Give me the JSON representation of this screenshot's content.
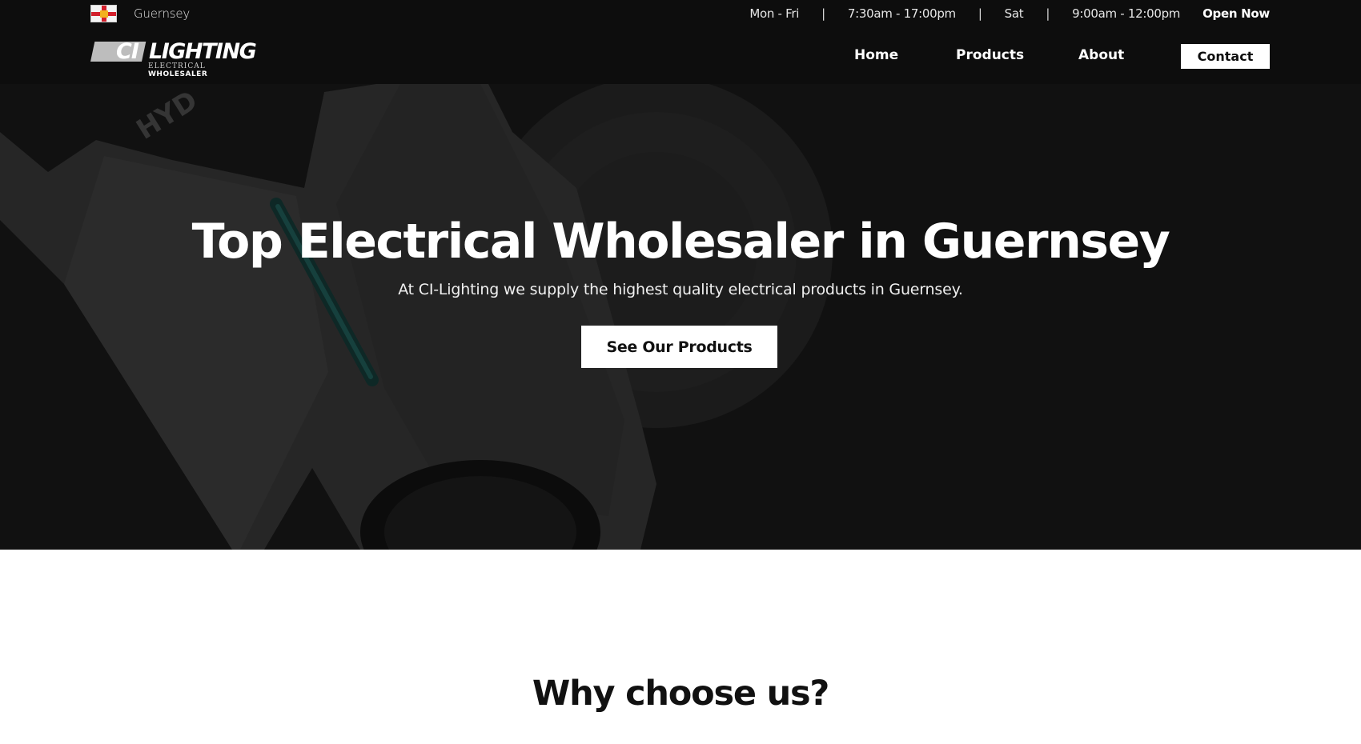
{
  "topbar": {
    "location": "Guernsey",
    "flag_icon": "guernsey-flag-icon",
    "weekday_label": "Mon - Fri",
    "weekday_hours": "7:30am - 17:00pm",
    "saturday_label": "Sat",
    "saturday_hours": "9:00am - 12:00pm",
    "status": "Open Now",
    "separator": "|"
  },
  "logo": {
    "mark": "CI",
    "name": "LIGHTING",
    "tagline_1": "ELECTRICAL",
    "tagline_2": "WHOLESALER"
  },
  "nav": {
    "home": "Home",
    "products": "Products",
    "about": "About",
    "contact": "Contact"
  },
  "hero": {
    "title": "Top Electrical Wholesaler in Guernsey",
    "subtitle": "At CI-Lighting we supply the highest quality electrical products in Guernsey.",
    "cta": "See Our Products",
    "watermark": "HYD"
  },
  "why": {
    "title": "Why choose us?"
  },
  "colors": {
    "header_bg": "#0d0d0d",
    "hero_bg": "#111111",
    "text_light": "#ffffff",
    "accent_flag_red": "#d3202c",
    "accent_flag_gold": "#f2b21e"
  }
}
